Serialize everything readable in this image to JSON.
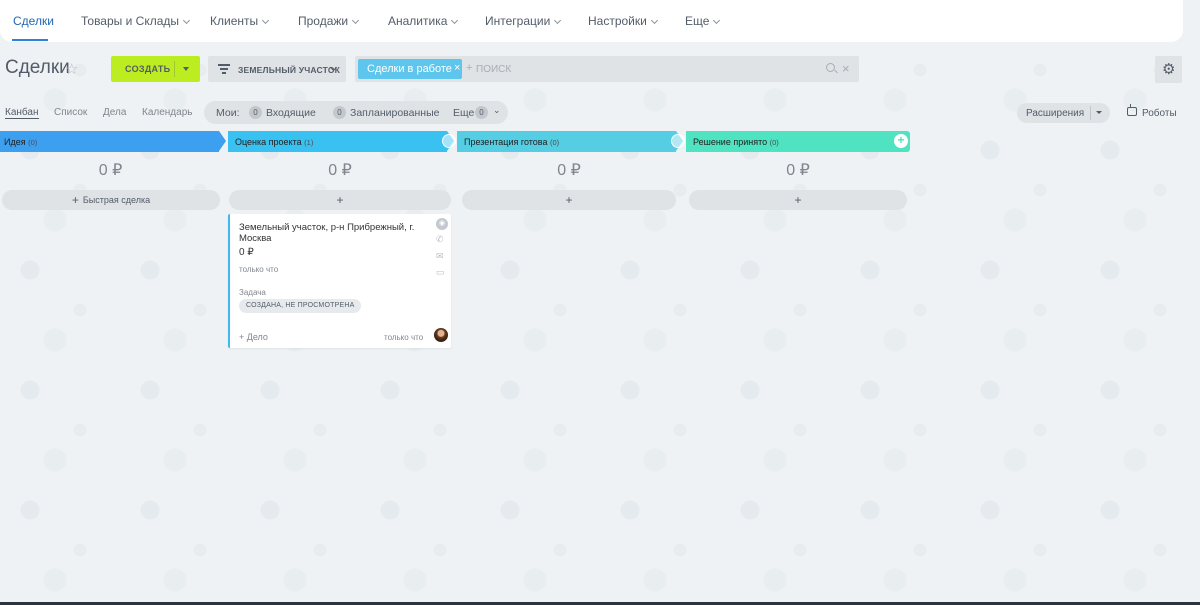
{
  "nav": {
    "items": [
      {
        "label": "Сделки",
        "active": true,
        "dropdown": false
      },
      {
        "label": "Товары и Склады",
        "active": false,
        "dropdown": true
      },
      {
        "label": "Клиенты",
        "active": false,
        "dropdown": true
      },
      {
        "label": "Продажи",
        "active": false,
        "dropdown": true
      },
      {
        "label": "Аналитика",
        "active": false,
        "dropdown": true
      },
      {
        "label": "Интеграции",
        "active": false,
        "dropdown": true
      },
      {
        "label": "Настройки",
        "active": false,
        "dropdown": true
      },
      {
        "label": "Еще",
        "active": false,
        "dropdown": true
      }
    ]
  },
  "toolbar": {
    "title": "Сделки",
    "create_label": "СОЗДАТЬ",
    "category_label": "ЗЕМЕЛЬНЫЙ УЧАСТОК",
    "filter_chip": "Сделки в работе",
    "search_placeholder": "поиск",
    "settings_icon": "gear-icon"
  },
  "views": [
    "Канбан",
    "Список",
    "Дела",
    "Календарь"
  ],
  "counters": {
    "label": "Мои:",
    "incoming_count": "0",
    "incoming_label": "Входящие",
    "planned_count": "0",
    "planned_label": "Запланированные",
    "more_label": "Еще",
    "more_count": "0"
  },
  "extensions_label": "Расширения",
  "robots_label": "Роботы",
  "stages": [
    {
      "name": "Идея",
      "count": "(0)",
      "color": "#3d9ff0",
      "sum": "0 ₽",
      "add": "Быстрая сделка"
    },
    {
      "name": "Оценка проекта",
      "count": "(1)",
      "color": "#39c1f1",
      "sum": "0 ₽",
      "add": ""
    },
    {
      "name": "Презентация готова",
      "count": "(0)",
      "color": "#55cde2",
      "sum": "0 ₽",
      "add": ""
    },
    {
      "name": "Решение принято",
      "count": "(0)",
      "color": "#4fe3c2",
      "sum": "0 ₽",
      "add": ""
    }
  ],
  "card": {
    "title": "Земельный участок, р-н Прибрежный, г. Москва",
    "amount": "0 ₽",
    "created": "только что",
    "task_label": "Задача",
    "task_status": "СОЗДАНА, НЕ ПРОСМОТРЕНА",
    "add_activity": "+ Дело",
    "activity_time": "только что",
    "accent": "#3fb9ee"
  }
}
